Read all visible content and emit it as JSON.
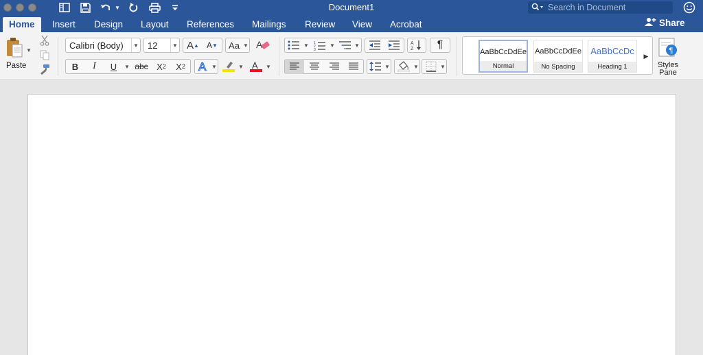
{
  "window": {
    "title": "Document1",
    "search_placeholder": "Search in Document"
  },
  "tabs": [
    {
      "label": "Home",
      "active": true
    },
    {
      "label": "Insert"
    },
    {
      "label": "Design"
    },
    {
      "label": "Layout"
    },
    {
      "label": "References"
    },
    {
      "label": "Mailings"
    },
    {
      "label": "Review"
    },
    {
      "label": "View"
    },
    {
      "label": "Acrobat"
    }
  ],
  "share_label": "Share",
  "clipboard": {
    "paste_label": "Paste"
  },
  "font": {
    "family": "Calibri (Body)",
    "size": "12",
    "bold": "B",
    "italic": "I",
    "underline": "U",
    "strikethrough": "abc",
    "subscript": "X",
    "subscript_mark": "2",
    "superscript": "X",
    "superscript_mark": "2",
    "grow": "A",
    "shrink": "A",
    "case": "Aa",
    "effects": "A",
    "color_letter": "A",
    "highlight_color": "#f5e400",
    "font_color": "#e81123"
  },
  "paragraph": {
    "pilcrow": "¶"
  },
  "styles": [
    {
      "sample": "AaBbCcDdEe",
      "name": "Normal",
      "selected": true
    },
    {
      "sample": "AaBbCcDdEe",
      "name": "No Spacing"
    },
    {
      "sample": "AaBbCcDc",
      "name": "Heading 1",
      "color": "#4472c4"
    }
  ],
  "styles_pane": {
    "line1": "Styles",
    "line2": "Pane"
  },
  "colors": {
    "accent": "#2b579a",
    "ribbon": "#f3f3f3",
    "workspace": "#e6e6e6"
  }
}
